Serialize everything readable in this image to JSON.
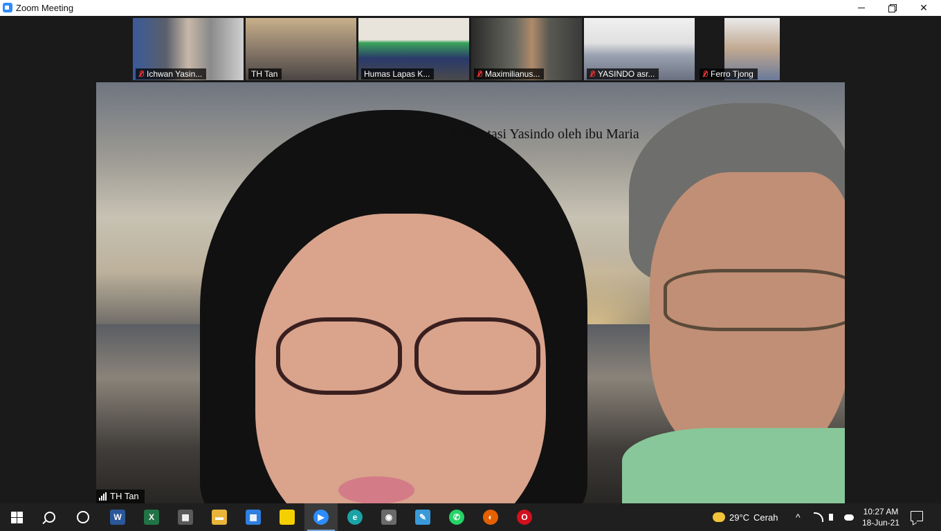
{
  "window": {
    "title": "Zoom Meeting",
    "minimize_glyph": "",
    "maximize_glyph": "",
    "close_glyph": "✕"
  },
  "thumbnails": [
    {
      "name": "Ichwan Yasin...",
      "muted": true,
      "active": false
    },
    {
      "name": "TH Tan",
      "muted": false,
      "active": true
    },
    {
      "name": "Humas Lapas K...",
      "muted": false,
      "active": false
    },
    {
      "name": "Maximilianus...",
      "muted": true,
      "active": false
    },
    {
      "name": "YASINDO asr...",
      "muted": true,
      "active": false
    },
    {
      "name": "Ferro Tjong",
      "muted": true,
      "active": false
    }
  ],
  "main_video": {
    "caption": "Presentasi Yasindo oleh ibu Maria",
    "speaker": "TH Tan"
  },
  "taskbar": {
    "apps": [
      {
        "icon": "windows-start-icon"
      },
      {
        "icon": "search-icon"
      },
      {
        "icon": "cortana-icon"
      },
      {
        "icon": "word-icon",
        "glyph": "W",
        "color": "#2b579a"
      },
      {
        "icon": "excel-icon",
        "glyph": "X",
        "color": "#217346"
      },
      {
        "icon": "calculator-icon",
        "glyph": "▦",
        "color": "#5a5a5a"
      },
      {
        "icon": "file-explorer-icon",
        "glyph": "▬",
        "color": "#e8b53a"
      },
      {
        "icon": "calendar-icon",
        "glyph": "▦",
        "color": "#2f7fe0"
      },
      {
        "icon": "sticky-notes-icon",
        "glyph": "",
        "color": "#f5d000"
      },
      {
        "icon": "zoom-icon",
        "glyph": "▶",
        "color": "#2d8cff"
      },
      {
        "icon": "edge-icon",
        "glyph": "e",
        "color": "#1aa3a6"
      },
      {
        "icon": "camera-icon",
        "glyph": "◉",
        "color": "#6a6a6a"
      },
      {
        "icon": "photo-app-icon",
        "glyph": "✎",
        "color": "#3a9ad9"
      },
      {
        "icon": "whatsapp-icon",
        "glyph": "✆",
        "color": "#25d366"
      },
      {
        "icon": "firefox-icon",
        "glyph": "◐",
        "color": "#e66000"
      },
      {
        "icon": "opera-icon",
        "glyph": "O",
        "color": "#d2101e"
      }
    ],
    "weather": {
      "temp": "29°C",
      "condition": "Cerah"
    },
    "tray_up_glyph": "^",
    "clock": {
      "time": "10:27 AM",
      "date": "18-Jun-21"
    }
  }
}
